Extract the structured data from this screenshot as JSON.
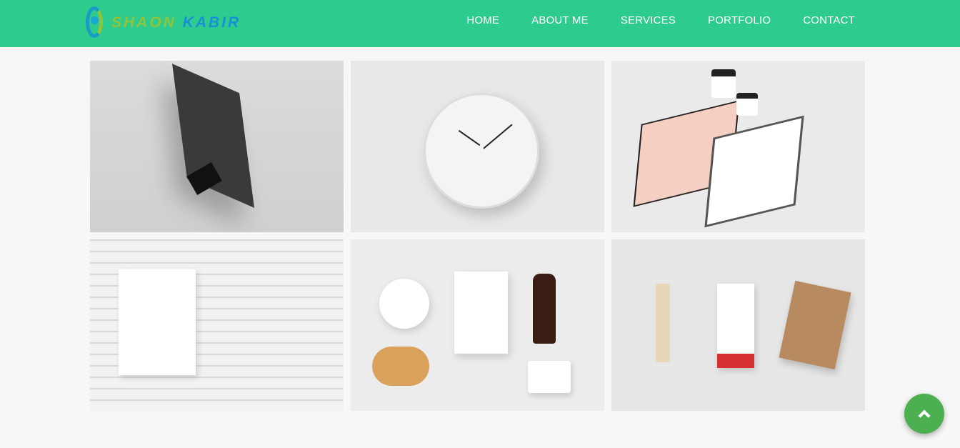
{
  "header": {
    "logo": {
      "part1": "SHAON",
      "part2": "KABIR"
    },
    "nav": [
      {
        "label": "HOME"
      },
      {
        "label": "ABOUT ME"
      },
      {
        "label": "SERVICES"
      },
      {
        "label": "PORTFOLIO"
      },
      {
        "label": "CONTACT"
      }
    ],
    "bg_color": "#2ecb8e"
  },
  "portfolio": {
    "items": [
      {
        "subject": "business card in binder clip"
      },
      {
        "subject": "wall clock"
      },
      {
        "subject": "stationery set"
      },
      {
        "subject": "menu on brick wall"
      },
      {
        "subject": "coffee branding"
      },
      {
        "subject": "matches and sugar packet"
      }
    ]
  },
  "back_to_top": {
    "icon": "chevron-up-icon",
    "color": "#4caf50"
  }
}
